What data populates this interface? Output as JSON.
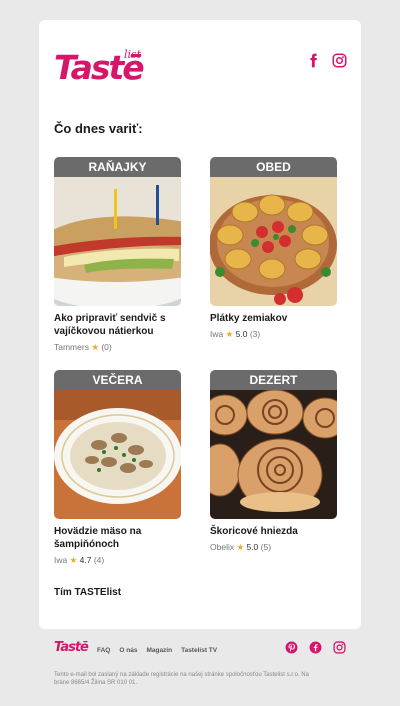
{
  "brand": {
    "logo": "Tastē",
    "logo_sub": "list",
    "color": "#d6166b"
  },
  "header": {
    "social_icons": [
      "facebook-icon",
      "instagram-icon"
    ]
  },
  "heading": "Čo dnes variť:",
  "recipes": [
    {
      "category": "RAŇAJKY",
      "title": "Ako pripraviť sendvič s vajíčkovou nátierkou",
      "author": "Tammers",
      "score": "",
      "reviews": "(0)",
      "image": "sandwich"
    },
    {
      "category": "OBED",
      "title": "Plátky zemiakov",
      "author": "Iwa",
      "score": "5.0",
      "reviews": "(3)",
      "image": "potato-patties"
    },
    {
      "category": "VEČERA",
      "title": "Hovädzie mäso na šampiňónoch",
      "author": "Iwa",
      "score": "4.7",
      "reviews": "(4)",
      "image": "beef-mushrooms"
    },
    {
      "category": "DEZERT",
      "title": "Škoricové hniezda",
      "author": "Obelix",
      "score": "5.0",
      "reviews": "(5)",
      "image": "cinnamon-rolls"
    }
  ],
  "signature": "Tím TASTElist",
  "footer": {
    "logo": "Tastē",
    "links": [
      "FAQ",
      "O nás",
      "Magazín",
      "Tastelist TV"
    ],
    "social_icons": [
      "pinterest-icon",
      "facebook-icon",
      "instagram-icon"
    ],
    "disclaimer": "Tento e-mail bol zaslaný na základe registrácie na našej stránke spoločnosťou Tastelist s.r.o. Na bráne 8665/4 Žilina SR 010 01."
  }
}
